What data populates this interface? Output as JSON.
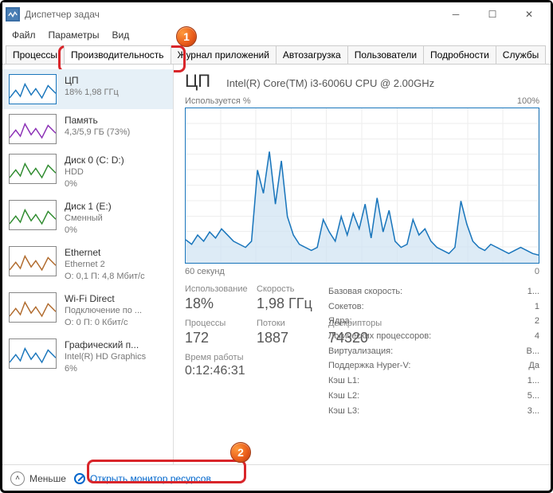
{
  "window": {
    "title": "Диспетчер задач"
  },
  "menu": {
    "file": "Файл",
    "options": "Параметры",
    "view": "Вид"
  },
  "tabs": {
    "processes": "Процессы",
    "performance": "Производительность",
    "app_history": "Журнал приложений",
    "startup": "Автозагрузка",
    "users": "Пользователи",
    "details": "Подробности",
    "services": "Службы"
  },
  "sidebar": [
    {
      "name": "ЦП",
      "sub1": "18% 1,98 ГГц",
      "sub2": "",
      "color": "#1a76bc"
    },
    {
      "name": "Память",
      "sub1": "4,3/5,9 ГБ (73%)",
      "sub2": "",
      "color": "#8b2fb5"
    },
    {
      "name": "Диск 0 (C: D:)",
      "sub1": "HDD",
      "sub2": "0%",
      "color": "#2e8b2e"
    },
    {
      "name": "Диск 1 (E:)",
      "sub1": "Сменный",
      "sub2": "0%",
      "color": "#2e8b2e"
    },
    {
      "name": "Ethernet",
      "sub1": "Ethernet 2",
      "sub2": "О: 0,1 П: 4,8 Мбит/с",
      "color": "#b06a2c"
    },
    {
      "name": "Wi-Fi Direct",
      "sub1": "Подключение по ...",
      "sub2": "О: 0 П: 0 Кбит/с",
      "color": "#b06a2c"
    },
    {
      "name": "Графический п...",
      "sub1": "Intel(R) HD Graphics",
      "sub2": "6%",
      "color": "#1a76bc"
    }
  ],
  "main": {
    "title": "ЦП",
    "subtitle": "Intel(R) Core(TM) i3-6006U CPU @ 2.00GHz",
    "chart_top_left": "Используется %",
    "chart_top_right": "100%",
    "chart_bot_left": "60 секунд",
    "chart_bot_right": "0",
    "uptime_label": "Время работы",
    "uptime": "0:12:46:31"
  },
  "stats": {
    "usage_l": "Использование",
    "usage_v": "18%",
    "speed_l": "Скорость",
    "speed_v": "1,98 ГГц",
    "proc_l": "Процессы",
    "proc_v": "172",
    "thr_l": "Потоки",
    "thr_v": "1887",
    "hnd_l": "Дескрипторы",
    "hnd_v": "74320"
  },
  "meta": {
    "base_l": "Базовая скорость:",
    "base_v": "1...",
    "sock_l": "Сокетов:",
    "sock_v": "1",
    "core_l": "Ядра:",
    "core_v": "2",
    "lproc_l": "Логических процессоров:",
    "lproc_v": "4",
    "virt_l": "Виртуализация:",
    "virt_v": "В...",
    "hv_l": "Поддержка Hyper-V:",
    "hv_v": "Да",
    "l1_l": "Кэш L1:",
    "l1_v": "1...",
    "l2_l": "Кэш L2:",
    "l2_v": "5...",
    "l3_l": "Кэш L3:",
    "l3_v": "3..."
  },
  "footer": {
    "less": "Меньше",
    "rmon": "Открыть монитор ресурсов"
  },
  "badges": {
    "b1": "1",
    "b2": "2"
  },
  "chart_data": {
    "type": "line",
    "title": "Используется %",
    "ylabel": "%",
    "xlabel": "секунд",
    "ylim": [
      0,
      100
    ],
    "xlim": [
      60,
      0
    ],
    "values": [
      15,
      12,
      18,
      14,
      20,
      16,
      22,
      18,
      14,
      12,
      10,
      14,
      60,
      45,
      72,
      38,
      66,
      30,
      18,
      12,
      10,
      8,
      10,
      28,
      20,
      14,
      30,
      18,
      32,
      22,
      38,
      16,
      42,
      20,
      34,
      14,
      10,
      12,
      28,
      18,
      22,
      14,
      10,
      8,
      6,
      10,
      40,
      25,
      14,
      10,
      8,
      12,
      10,
      8,
      6,
      8,
      10,
      8,
      6,
      5
    ]
  }
}
